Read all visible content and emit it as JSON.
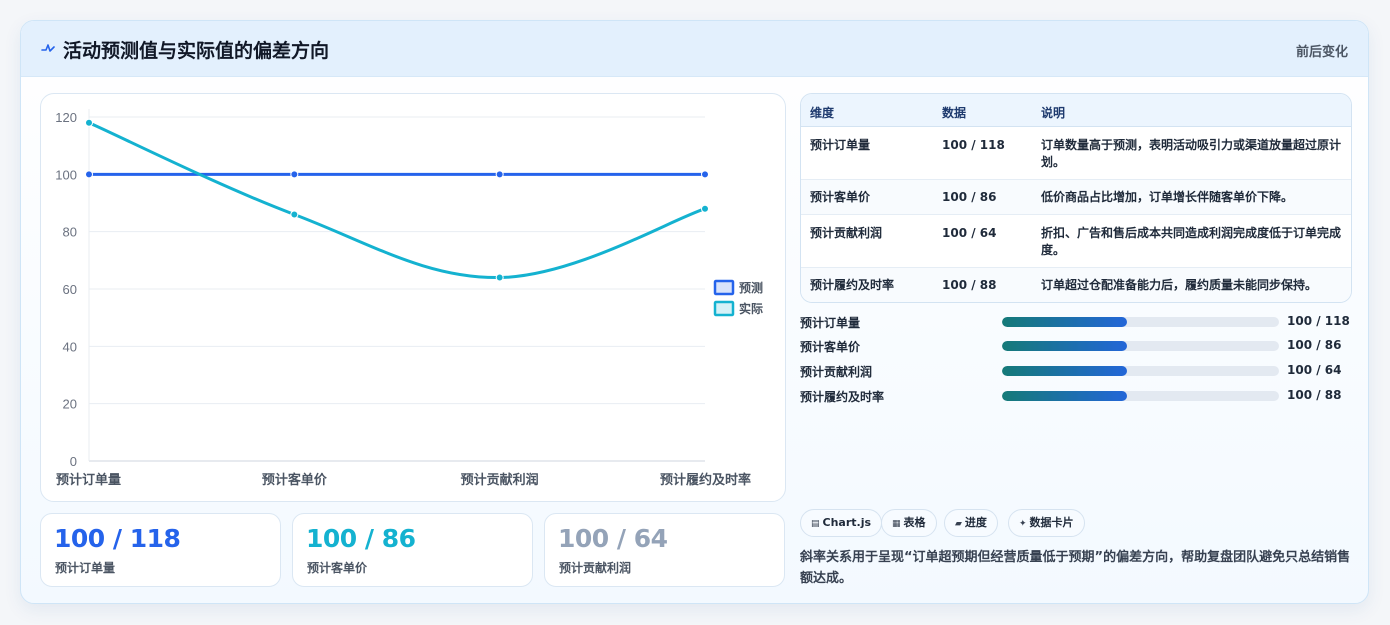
{
  "header": {
    "title": "活动预测值与实际值的偏差方向",
    "action": "前后变化",
    "icon": "pulse-icon"
  },
  "colors": {
    "forecast": "#2563eb",
    "actual": "#14b2d0",
    "muted": "#94a3b8"
  },
  "chart_data": {
    "type": "line",
    "categories": [
      "预计订单量",
      "预计客单价",
      "预计贡献利润",
      "预计履约及时率"
    ],
    "series": [
      {
        "name": "预测",
        "values": [
          100,
          100,
          100,
          100
        ],
        "color": "#2563eb"
      },
      {
        "name": "实际",
        "values": [
          118,
          86,
          64,
          88
        ],
        "color": "#14b2d0"
      }
    ],
    "ylim": [
      0,
      120
    ],
    "yticks": [
      "0",
      "20",
      "40",
      "60",
      "80",
      "100",
      "120"
    ],
    "grid": true,
    "legend": "right"
  },
  "kpis": [
    {
      "value": "100 / 118",
      "label": "预计订单量",
      "color": "#2563eb"
    },
    {
      "value": "100 / 86",
      "label": "预计客单价",
      "color": "#14b2d0"
    },
    {
      "value": "100 / 64",
      "label": "预计贡献利润",
      "color": "#94a3b8"
    }
  ],
  "table": {
    "headers": [
      "维度",
      "数据",
      "说明"
    ],
    "rows": [
      {
        "dim": "预计订单量",
        "data": "100 / 118",
        "note": "订单数量高于预测，表明活动吸引力或渠道放量超过原计划。"
      },
      {
        "dim": "预计客单价",
        "data": "100 / 86",
        "note": "低价商品占比增加，订单增长伴随客单价下降。"
      },
      {
        "dim": "预计贡献利润",
        "data": "100 / 64",
        "note": "折扣、广告和售后成本共同造成利润完成度低于订单完成度。"
      },
      {
        "dim": "预计履约及时率",
        "data": "100 / 88",
        "note": "订单超过仓配准备能力后，履约质量未能同步保持。"
      }
    ]
  },
  "progress": [
    {
      "label": "预计订单量",
      "value": "100 / 118",
      "fill": 0.45
    },
    {
      "label": "预计客单价",
      "value": "100 / 86",
      "fill": 0.45
    },
    {
      "label": "预计贡献利润",
      "value": "100 / 64",
      "fill": 0.45
    },
    {
      "label": "预计履约及时率",
      "value": "100 / 88",
      "fill": 0.45
    }
  ],
  "tags": [
    {
      "icon": "▤",
      "label": "Chart.js"
    },
    {
      "icon": "▦",
      "label": "表格"
    },
    {
      "icon": "▰",
      "label": "进度"
    },
    {
      "icon": "✦",
      "label": "数据卡片"
    }
  ],
  "summary": "斜率关系用于呈现“订单超预期但经营质量低于预期”的偏差方向，帮助复盘团队避免只总结销售额达成。"
}
